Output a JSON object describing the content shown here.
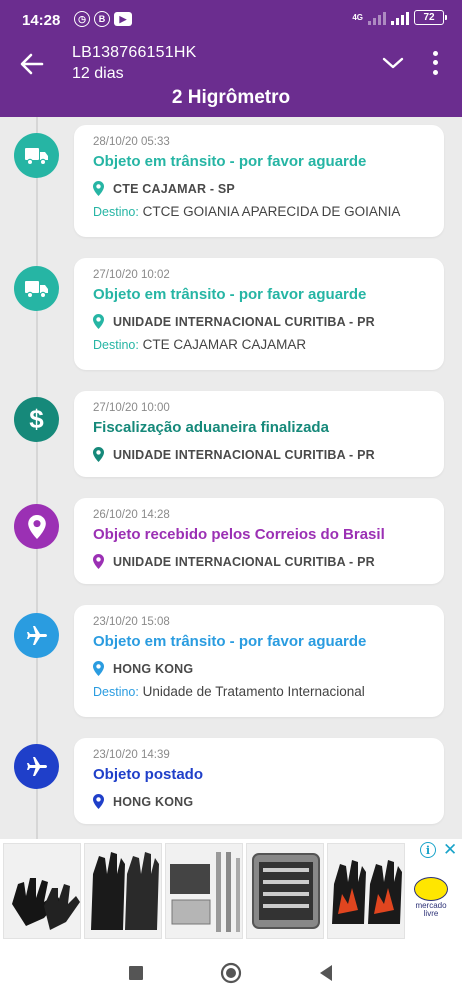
{
  "status_bar": {
    "time": "14:28",
    "network": "4G",
    "battery": "72",
    "notif_b": "B"
  },
  "header": {
    "tracking_code": "LB138766151HK",
    "days": "12 dias",
    "title": "2 Higrômetro"
  },
  "colors": {
    "brand_purple": "#6b2d8f",
    "transit_green": "#26b5a4",
    "customs_teal": "#16897a",
    "received_purple": "#9b30b4",
    "transit_blue": "#2a9ce0",
    "posted_blue": "#1f3fc9"
  },
  "events": [
    {
      "date": "28/10/20 05:33",
      "status": "Objeto em trânsito - por favor aguarde",
      "location": "CTE CAJAMAR - SP",
      "destination_label": "Destino:",
      "destination": "CTCE GOIANIA APARECIDA DE GOIANIA",
      "icon": "truck-icon",
      "color": "#26b5a4"
    },
    {
      "date": "27/10/20 10:02",
      "status": "Objeto em trânsito - por favor aguarde",
      "location": "UNIDADE INTERNACIONAL CURITIBA - PR",
      "destination_label": "Destino:",
      "destination": "CTE CAJAMAR CAJAMAR",
      "icon": "truck-icon",
      "color": "#26b5a4"
    },
    {
      "date": "27/10/20 10:00",
      "status": "Fiscalização aduaneira finalizada",
      "location": "UNIDADE INTERNACIONAL CURITIBA - PR",
      "icon": "dollar-icon",
      "color": "#16897a"
    },
    {
      "date": "26/10/20 14:28",
      "status": "Objeto recebido pelos Correios do Brasil",
      "location": "UNIDADE INTERNACIONAL CURITIBA - PR",
      "icon": "location-pin-icon",
      "color": "#9b30b4"
    },
    {
      "date": "23/10/20 15:08",
      "status": "Objeto em trânsito - por favor aguarde",
      "location": "HONG KONG",
      "destination_label": "Destino:",
      "destination": "Unidade de Tratamento Internacional",
      "icon": "airplane-icon",
      "color": "#2a9ce0"
    },
    {
      "date": "23/10/20 14:39",
      "status": "Objeto postado",
      "location": "HONG KONG",
      "icon": "airplane-icon",
      "color": "#1f3fc9"
    }
  ],
  "ad": {
    "info": "i",
    "close": "✕",
    "brand_text": "mercado livre",
    "products": [
      "gloves",
      "heat-resistant-gloves",
      "bbq-tool-set",
      "knife-case",
      "bbq-gloves-flame"
    ]
  }
}
